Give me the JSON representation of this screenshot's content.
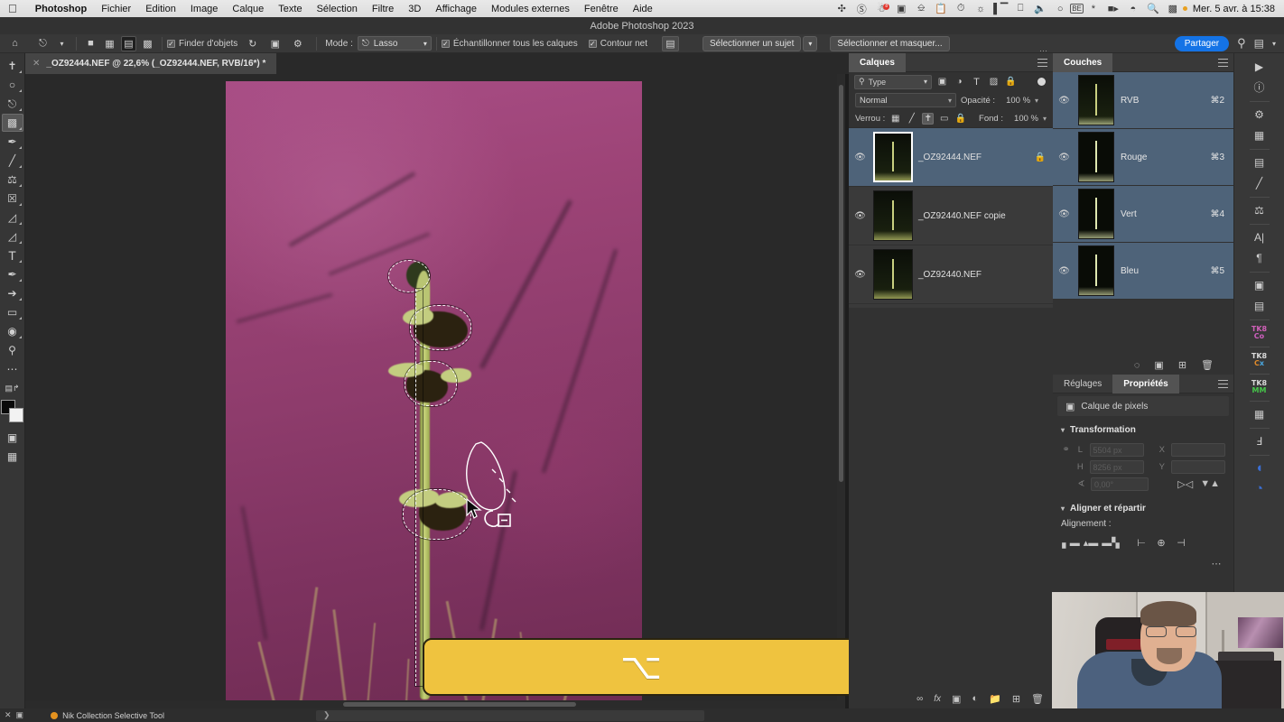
{
  "macos": {
    "apple_logo": "apple-logo",
    "app_name": "Photoshop",
    "menus": [
      "Fichier",
      "Edition",
      "Image",
      "Calque",
      "Texte",
      "Sélection",
      "Filtre",
      "3D",
      "Affichage",
      "Modules externes",
      "Fenêtre",
      "Aide"
    ],
    "status_icons": [
      "vpn-icon",
      "dnd-icon",
      "notif-badge-icon",
      "screen-record-icon",
      "airplay-icon",
      "clipboard-icon",
      "time-machine-icon",
      "search-spotlight-alt-icon",
      "stats-icon",
      "display-icon",
      "volume-icon",
      "wifi-alt-icon",
      "keyboard-layout-be-icon",
      "bluetooth-icon",
      "battery-icon",
      "wifi-icon",
      "spotlight-icon",
      "control-center-icon"
    ],
    "keyboard_layout": "BE",
    "clock": "Mer. 5 avr. à 15:38"
  },
  "window": {
    "title": "Adobe Photoshop 2023",
    "traffic_lights": [
      "close-button",
      "minimize-button",
      "zoom-button"
    ]
  },
  "options_bar": {
    "home_icon": "home-icon",
    "tool_preset_icon": "lasso-tool-preset-icon",
    "selection_modes": [
      "new-selection-icon",
      "add-to-selection-icon",
      "subtract-from-selection-icon",
      "intersect-selection-icon"
    ],
    "active_selection_mode_index": 2,
    "object_finder_label": "Finder d'objets",
    "object_finder_checked": true,
    "refresh_icon": "refresh-icon",
    "show_overlay_icon": "show-overlay-icon",
    "gear_icon": "gear-icon",
    "mode_label": "Mode :",
    "mode_value": "Lasso",
    "sample_all_layers_label": "Échantillonner tous les calques",
    "sample_all_layers_checked": true,
    "sharp_edge_label": "Contour net",
    "sharp_edge_checked": true,
    "brush_options_icon": "brush-options-icon",
    "select_subject_label": "Sélectionner un sujet",
    "select_and_mask_label": "Sélectionner et masquer...",
    "share_label": "Partager",
    "search_icon": "search-icon",
    "workspace_icon": "workspace-icon",
    "chevron_icon": "chevron-down-icon"
  },
  "document": {
    "tab_close_icon": "close-icon",
    "tab_title": "_OZ92444.NEF @ 22,6% (_OZ92444.NEF, RVB/16*) *",
    "zoom": "22,6%",
    "color_mode": "RVB/16*"
  },
  "left_toolbar": {
    "tools": [
      {
        "name": "move-tool",
        "glyph": "✥"
      },
      {
        "name": "elliptical-marquee-tool",
        "glyph": "◌"
      },
      {
        "name": "lasso-tool",
        "glyph": "🅠"
      },
      {
        "name": "object-selection-tool",
        "glyph": "⬚"
      },
      {
        "name": "healing-brush-tool",
        "glyph": "✎"
      },
      {
        "name": "brush-tool",
        "glyph": "🖌"
      },
      {
        "name": "clone-stamp-tool",
        "glyph": "⛃"
      },
      {
        "name": "history-brush-tool",
        "glyph": "⧖"
      },
      {
        "name": "eraser-tool",
        "glyph": "⌫"
      },
      {
        "name": "gradient-tool",
        "glyph": "◧"
      },
      {
        "name": "type-tool",
        "glyph": "T"
      },
      {
        "name": "pen-tool",
        "glyph": "✒"
      },
      {
        "name": "path-selection-tool",
        "glyph": "➚"
      },
      {
        "name": "rectangle-tool",
        "glyph": "▭"
      },
      {
        "name": "dodge-tool",
        "glyph": "◍"
      },
      {
        "name": "zoom-tool",
        "glyph": "⌕"
      },
      {
        "name": "edit-toolbar-more",
        "glyph": "⋯"
      }
    ],
    "selected_tool_index": 3,
    "quick_mask_icon": "quick-mask-icon",
    "screen_mode_icon": "screen-mode-icon",
    "foreground_color": "#0a0a0a",
    "background_color": "#f2f2f2"
  },
  "layers_panel": {
    "title": "Calques",
    "panel_menu_icon": "panel-menu-icon",
    "filter_placeholder": "Type",
    "filter_icons": [
      "filter-pixel-icon",
      "filter-adjustment-icon",
      "filter-type-icon",
      "filter-shape-icon",
      "filter-smart-icon"
    ],
    "filter_toggle": "filter-enable-toggle",
    "blend_mode": "Normal",
    "opacity_label": "Opacité :",
    "opacity_value": "100 %",
    "lock_label": "Verrou :",
    "lock_icons": [
      "lock-transparency-icon",
      "lock-image-icon",
      "lock-position-icon",
      "lock-artboard-icon",
      "lock-all-icon"
    ],
    "lock_active_index": 2,
    "fill_label": "Fond :",
    "fill_value": "100 %",
    "layers": [
      {
        "name": "_OZ92444.NEF",
        "visible": true,
        "selected": true,
        "locked": true
      },
      {
        "name": "_OZ92440.NEF copie",
        "visible": true,
        "selected": false,
        "locked": false
      },
      {
        "name": "_OZ92440.NEF",
        "visible": true,
        "selected": false,
        "locked": false
      }
    ],
    "footer_icons": [
      "link-layers-icon",
      "layer-style-fx-icon",
      "add-mask-icon",
      "adjustment-layer-icon",
      "new-group-icon",
      "new-layer-icon",
      "delete-layer-icon"
    ]
  },
  "channels_panel": {
    "title": "Couches",
    "panel_menu_icon": "panel-menu-icon",
    "channels": [
      {
        "name": "RVB",
        "shortcut": "⌘2",
        "visible": true,
        "selected": true
      },
      {
        "name": "Rouge",
        "shortcut": "⌘3",
        "visible": true,
        "selected": true
      },
      {
        "name": "Vert",
        "shortcut": "⌘4",
        "visible": true,
        "selected": true
      },
      {
        "name": "Bleu",
        "shortcut": "⌘5",
        "visible": true,
        "selected": true
      }
    ],
    "footer_icons": [
      "load-channel-as-selection-icon",
      "save-selection-as-channel-icon",
      "new-channel-icon",
      "delete-channel-icon"
    ]
  },
  "properties_panel": {
    "tabs": [
      {
        "label": "Réglages",
        "active": false
      },
      {
        "label": "Propriétés",
        "active": true
      }
    ],
    "panel_menu_icon": "panel-menu-icon",
    "layer_kind_icon": "pixel-layer-icon",
    "layer_kind_label": "Calque de pixels",
    "sections": [
      {
        "title": "Transformation",
        "expanded": true,
        "link_icon": "link-dimensions-icon",
        "fields": [
          {
            "label": "L",
            "value": "5504 px"
          },
          {
            "label": "H",
            "value": "8256 px"
          },
          {
            "label": "X",
            "value": ""
          },
          {
            "label": "Y",
            "value": ""
          },
          {
            "label": "angle-icon",
            "value": "0,00°"
          }
        ],
        "flip_icons": [
          "flip-horizontal-icon",
          "flip-vertical-icon"
        ]
      },
      {
        "title": "Aligner et répartir",
        "expanded": true,
        "subtitle": "Alignement :",
        "align_icons": [
          "align-left-edges-icon",
          "align-horizontal-centers-icon",
          "align-right-edges-icon",
          "align-top-edges-icon",
          "align-vertical-centers-icon",
          "align-bottom-edges-icon"
        ],
        "more_icon": "more-options-icon"
      }
    ]
  },
  "right_rail": {
    "icons": [
      {
        "name": "play-actions-icon",
        "glyph": "▶"
      },
      {
        "name": "info-icon",
        "glyph": "ⓘ"
      },
      {
        "name": "color-palette-icon",
        "glyph": "🎨"
      },
      {
        "name": "swatches-grid-icon",
        "glyph": "▦"
      },
      {
        "name": "adjustments-sliders-icon",
        "glyph": "🎚"
      },
      {
        "name": "brush-settings-icon",
        "glyph": "🖌"
      },
      {
        "name": "clone-source-icon",
        "glyph": "⛃"
      },
      {
        "name": "character-panel-icon",
        "glyph": "A"
      },
      {
        "name": "paragraph-panel-icon",
        "glyph": "¶"
      },
      {
        "name": "libraries-icon",
        "glyph": "▤"
      },
      {
        "name": "notes-icon",
        "glyph": "▣"
      },
      {
        "name": "tk-color-icon",
        "glyph": "TK8 Co"
      },
      {
        "name": "tk-cx-icon",
        "glyph": "TK8 Cx"
      },
      {
        "name": "tk-mm-icon",
        "glyph": "TK8 MM"
      },
      {
        "name": "calendar-icon",
        "glyph": "▥"
      },
      {
        "name": "histogram-icon",
        "glyph": "⑂"
      },
      {
        "name": "blue-circle-icon",
        "glyph": "◕"
      },
      {
        "name": "blue-pie-icon",
        "glyph": "◔"
      }
    ]
  },
  "key_overlay": {
    "key_symbol": "⌥",
    "key_name": "option-alt-key",
    "background_color": "#efc33f"
  },
  "status_bar": {
    "screen_mode_icons": [
      "close-panel-icon",
      "expand-panel-icon"
    ],
    "plugin_status": "Nik Collection Selective Tool",
    "plugin_dot_color": "#e4921f",
    "field_glyph": "❯"
  },
  "webcam": {
    "name": "presenter-webcam-overlay"
  }
}
